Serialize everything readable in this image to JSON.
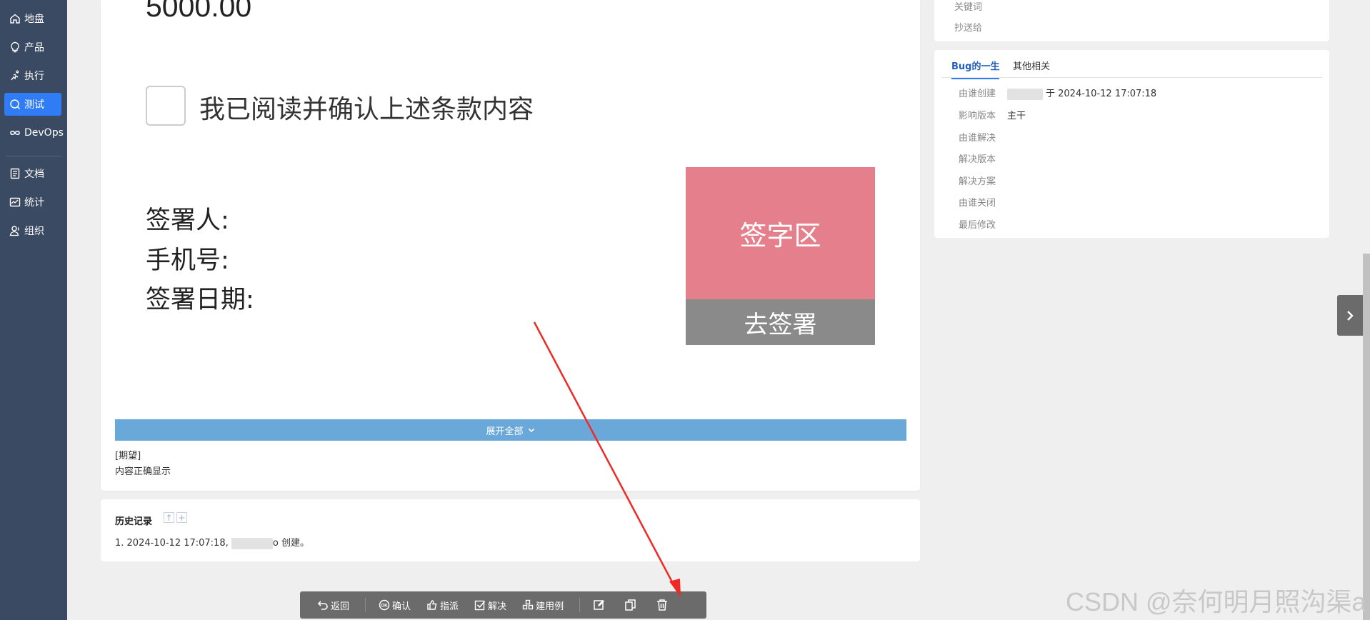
{
  "sidebar": {
    "items": [
      {
        "label": "地盘",
        "icon": "home-icon"
      },
      {
        "label": "产品",
        "icon": "lightbulb-icon"
      },
      {
        "label": "执行",
        "icon": "run-icon"
      },
      {
        "label": "测试",
        "icon": "search-test-icon"
      },
      {
        "label": "DevOps",
        "icon": "infinity-icon"
      },
      {
        "label": "文档",
        "icon": "document-icon"
      },
      {
        "label": "统计",
        "icon": "chart-icon"
      },
      {
        "label": "组织",
        "icon": "user-group-icon"
      }
    ],
    "active": "测试"
  },
  "content": {
    "amount": "5000.00",
    "agree_text": "我已阅读并确认上述条款内容",
    "signer_label": "签署人:",
    "phone_label": "手机号:",
    "date_label": "签署日期:",
    "sign_area_label": "签字区",
    "sign_button_label": "去签署",
    "expand_all_label": "展开全部",
    "expect_label": "[期望]",
    "expect_text": "内容正确显示"
  },
  "history": {
    "title": "历史记录",
    "entry_prefix": "1. 2024-10-12 17:07:18, ",
    "entry_suffix": "o 创建。"
  },
  "right_top": {
    "keyword_label": "关键词",
    "cc_label": "抄送给"
  },
  "life": {
    "tabs": [
      "Bug的一生",
      "其他相关"
    ],
    "active_tab": "Bug的一生",
    "rows": [
      {
        "label": "由谁创建",
        "value": "于 2024-10-12 17:07:18"
      },
      {
        "label": "影响版本",
        "value": "主干"
      },
      {
        "label": "由谁解决",
        "value": ""
      },
      {
        "label": "解决版本",
        "value": ""
      },
      {
        "label": "解决方案",
        "value": ""
      },
      {
        "label": "由谁关闭",
        "value": ""
      },
      {
        "label": "最后修改",
        "value": ""
      }
    ]
  },
  "toolbar": {
    "back_label": "返回",
    "confirm_label": "确认",
    "assign_label": "指派",
    "resolve_label": "解决",
    "create_case_label": "建用例"
  },
  "watermark": "CSDN @奈何明月照沟渠a",
  "colors": {
    "sidebar_bg": "#3b4a63",
    "active_nav": "#2f7cf6",
    "sign_area": "#e57f8b",
    "expand_bar": "#69a8d8",
    "annotation_arrow": "#ee2a24"
  }
}
